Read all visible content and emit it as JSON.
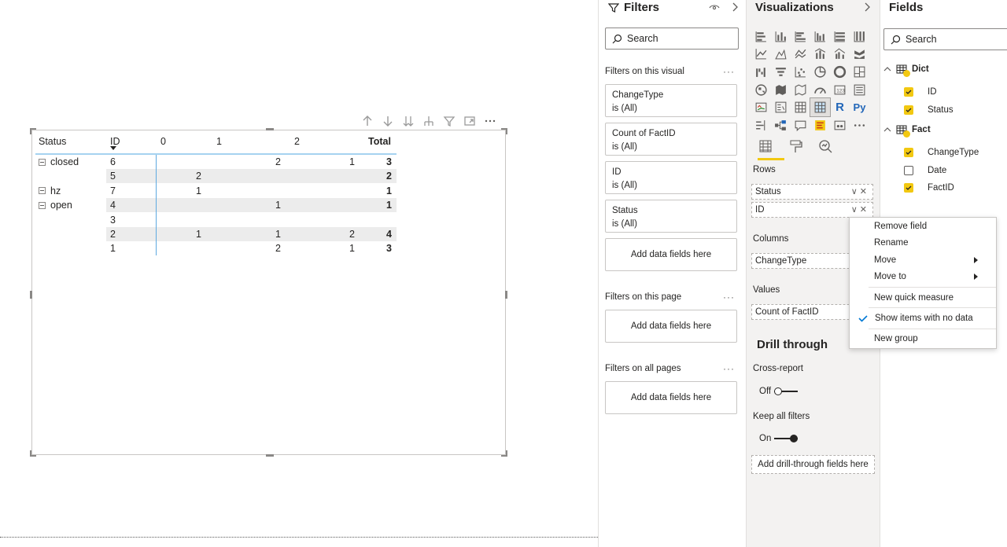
{
  "matrix": {
    "headers": {
      "status": "Status",
      "id": "ID",
      "col0": "0",
      "col1": "1",
      "col2": "2",
      "total": "Total"
    },
    "rows": [
      {
        "status": "closed",
        "id": "6",
        "c0": "",
        "c1": "2",
        "c2": "1",
        "total": "3",
        "band": false
      },
      {
        "status": "",
        "id": "5",
        "c0": "2",
        "c1": "",
        "c2": "",
        "total": "2",
        "band": true
      },
      {
        "status": "hz",
        "id": "7",
        "c0": "1",
        "c1": "",
        "c2": "",
        "total": "1",
        "band": false
      },
      {
        "status": "open",
        "id": "4",
        "c0": "",
        "c1": "1",
        "c2": "",
        "total": "1",
        "band": true
      },
      {
        "status": "",
        "id": "3",
        "c0": "",
        "c1": "",
        "c2": "",
        "total": "",
        "band": false
      },
      {
        "status": "",
        "id": "2",
        "c0": "1",
        "c1": "1",
        "c2": "2",
        "total": "4",
        "band": true
      },
      {
        "status": "",
        "id": "1",
        "c0": "",
        "c1": "2",
        "c2": "1",
        "total": "3",
        "band": false
      }
    ]
  },
  "filters": {
    "title": "Filters",
    "search_placeholder": "Search",
    "on_visual_label": "Filters on this visual",
    "cards": [
      {
        "name": "ChangeType",
        "value": "is (All)"
      },
      {
        "name": "Count of FactID",
        "value": "is (All)"
      },
      {
        "name": "ID",
        "value": "is (All)"
      },
      {
        "name": "Status",
        "value": "is (All)"
      }
    ],
    "add_fields": "Add data fields here",
    "on_page_label": "Filters on this page",
    "on_all_pages_label": "Filters on all pages"
  },
  "viz": {
    "title": "Visualizations",
    "rows_label": "Rows",
    "rows_fields": [
      "Status",
      "ID"
    ],
    "columns_label": "Columns",
    "columns_field": "ChangeType",
    "values_label": "Values",
    "values_field": "Count of FactID",
    "drill_title": "Drill through",
    "cross_report_label": "Cross-report",
    "cross_report_state": "Off",
    "keep_filters_label": "Keep all filters",
    "keep_filters_state": "On",
    "drill_add": "Add drill-through fields here",
    "python_label": "Py",
    "r_label": "R"
  },
  "fields": {
    "title": "Fields",
    "search_placeholder": "Search",
    "tables": [
      {
        "name": "Dict",
        "fields": [
          {
            "name": "ID",
            "checked": true
          },
          {
            "name": "Status",
            "checked": true
          }
        ]
      },
      {
        "name": "Fact",
        "fields": [
          {
            "name": "ChangeType",
            "checked": true
          },
          {
            "name": "Date",
            "checked": false
          },
          {
            "name": "FactID",
            "checked": true
          }
        ]
      }
    ]
  },
  "context_menu": {
    "remove_field": "Remove field",
    "rename": "Rename",
    "move": "Move",
    "move_to": "Move to",
    "new_quick_measure": "New quick measure",
    "show_items_no_data": "Show items with no data",
    "new_group": "New group"
  },
  "colors": {
    "accent": "#f2c811",
    "selection_blue": "#5ea9e0",
    "pane_bg": "#f3f2f1"
  }
}
